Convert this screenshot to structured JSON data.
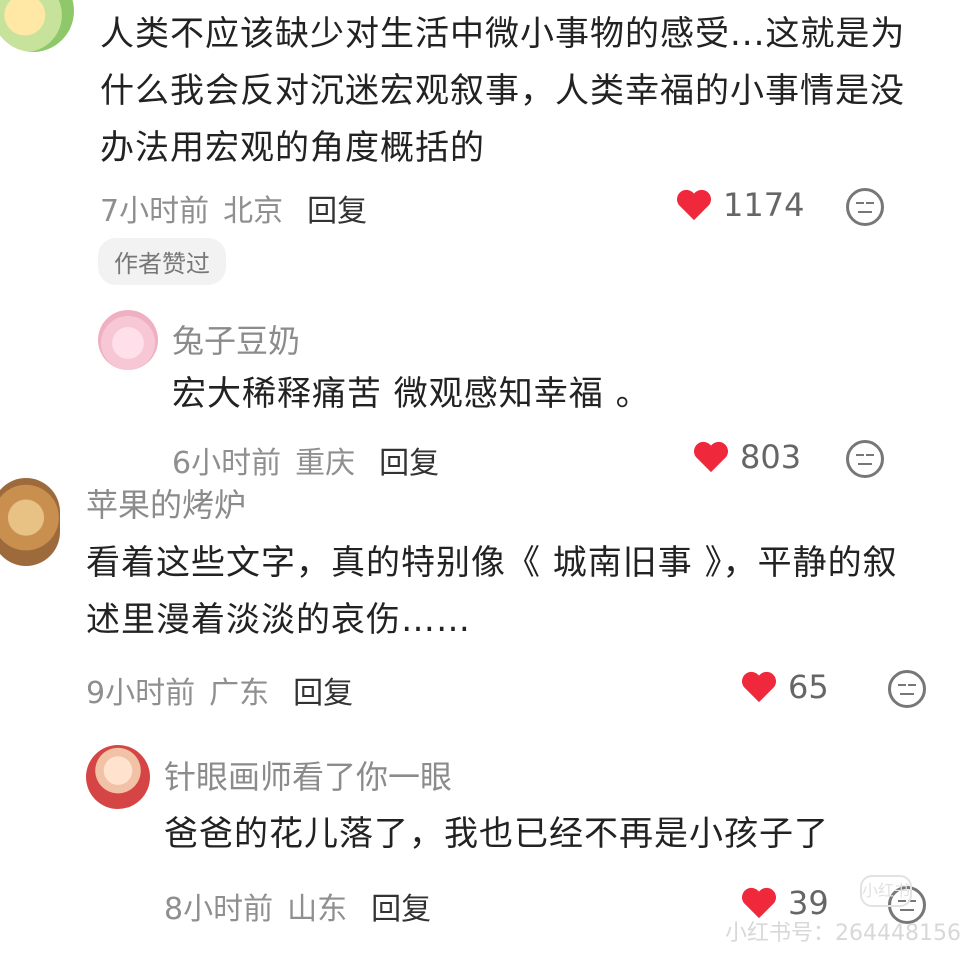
{
  "comments": [
    {
      "text_lines": [
        "人类不应该缺少对生活中微小事物的感受...这就是为",
        "什么我会反对沉迷宏观叙事，人类幸福的小事情是没",
        "办法用宏观的角度概括的"
      ],
      "time": "7小时前",
      "location": "北京",
      "reply_label": "回复",
      "likes": "1174",
      "badge": "作者赞过"
    },
    {
      "name": "兔子豆奶",
      "text": "宏大稀释痛苦 微观感知幸福 。",
      "time": "6小时前",
      "location": "重庆",
      "reply_label": "回复",
      "likes": "803"
    },
    {
      "name": "苹果的烤炉",
      "text_lines": [
        "看着这些文字，真的特别像《 城南旧事 》，平静的叙",
        "述里漫着淡淡的哀伤……"
      ],
      "time": "9小时前",
      "location": "广东",
      "reply_label": "回复",
      "likes": "65"
    },
    {
      "name": "针眼画师看了你一眼",
      "text": "爸爸的花儿落了，我也已经不再是小孩子了",
      "time": "8小时前",
      "location": "山东",
      "reply_label": "回复",
      "likes": "39"
    }
  ],
  "watermark": {
    "text": "小红书号：264448156",
    "logo": "小红书"
  },
  "colors": {
    "heart": "#f0283c",
    "meta": "#8f8f8f",
    "name": "#8b8b8b"
  },
  "icons": [
    "heart-icon",
    "emoji-icon"
  ]
}
